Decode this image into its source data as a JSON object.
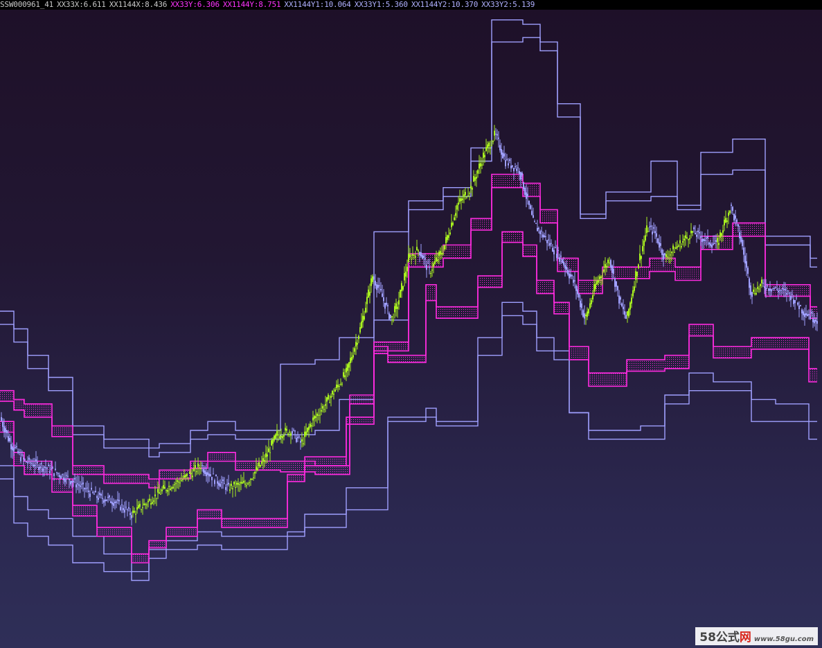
{
  "legend": {
    "items": [
      {
        "text": "SSW000961_41",
        "color": "#c8c8c8"
      },
      {
        "text": "XX33X:6.611",
        "color": "#c8c8c8"
      },
      {
        "text": "XX1144X:8.436",
        "color": "#c8c8c8"
      },
      {
        "text": "XX33Y:6.306",
        "color": "#ff33ff"
      },
      {
        "text": "XX1144Y:8.751",
        "color": "#ff33ff"
      },
      {
        "text": "XX1144Y1:10.064",
        "color": "#b0b0ff"
      },
      {
        "text": "XX33Y1:5.360",
        "color": "#b0b0ff"
      },
      {
        "text": "XX1144Y2:10.370",
        "color": "#b0b0ff"
      },
      {
        "text": "XX33Y2:5.139",
        "color": "#b0b0ff"
      }
    ]
  },
  "watermark": {
    "logo_num": "58",
    "logo_cn": "公式",
    "logo_net": "网",
    "url": "www.58gu.com"
  },
  "colors": {
    "up": "#a8f020",
    "down": "#a0a0ff",
    "band": "#ff2be0",
    "envelope": "#a0a0ff"
  },
  "chart_data": {
    "type": "line",
    "title": "SSW000961_41",
    "ylim": [
      4.2,
      11.4
    ],
    "price_path": [
      [
        0,
        6.8
      ],
      [
        15,
        6.5
      ],
      [
        35,
        6.3
      ],
      [
        60,
        6.25
      ],
      [
        100,
        6.1
      ],
      [
        140,
        5.9
      ],
      [
        165,
        5.85
      ],
      [
        190,
        5.7
      ],
      [
        215,
        5.85
      ],
      [
        240,
        6.0
      ],
      [
        265,
        6.1
      ],
      [
        290,
        6.25
      ],
      [
        310,
        6.1
      ],
      [
        330,
        6.0
      ],
      [
        355,
        6.05
      ],
      [
        380,
        6.3
      ],
      [
        400,
        6.6
      ],
      [
        420,
        6.65
      ],
      [
        435,
        6.5
      ],
      [
        450,
        6.75
      ],
      [
        470,
        6.95
      ],
      [
        500,
        7.3
      ],
      [
        520,
        7.8
      ],
      [
        538,
        8.4
      ],
      [
        550,
        8.2
      ],
      [
        565,
        7.9
      ],
      [
        575,
        8.1
      ],
      [
        590,
        8.6
      ],
      [
        605,
        8.7
      ],
      [
        620,
        8.45
      ],
      [
        640,
        8.7
      ],
      [
        660,
        9.2
      ],
      [
        680,
        9.4
      ],
      [
        700,
        9.8
      ],
      [
        715,
        10.0
      ],
      [
        730,
        9.7
      ],
      [
        750,
        9.6
      ],
      [
        770,
        9.0
      ],
      [
        790,
        8.8
      ],
      [
        810,
        8.6
      ],
      [
        830,
        8.3
      ],
      [
        845,
        7.9
      ],
      [
        860,
        8.3
      ],
      [
        880,
        8.6
      ],
      [
        895,
        8.1
      ],
      [
        905,
        7.9
      ],
      [
        920,
        8.5
      ],
      [
        935,
        8.95
      ],
      [
        945,
        8.9
      ],
      [
        960,
        8.6
      ],
      [
        980,
        8.75
      ],
      [
        1000,
        8.9
      ],
      [
        1020,
        8.8
      ],
      [
        1035,
        8.75
      ],
      [
        1055,
        9.2
      ],
      [
        1070,
        8.8
      ],
      [
        1085,
        8.2
      ],
      [
        1100,
        8.3
      ],
      [
        1120,
        8.25
      ],
      [
        1140,
        8.2
      ],
      [
        1160,
        8.0
      ],
      [
        1180,
        7.9
      ]
    ],
    "series": [
      {
        "name": "XX1144Y1",
        "color": "#a0a0ff",
        "steps": [
          [
            0,
            8.0
          ],
          [
            20,
            7.8
          ],
          [
            40,
            7.5
          ],
          [
            70,
            7.25
          ],
          [
            105,
            6.7
          ],
          [
            150,
            6.55
          ],
          [
            215,
            6.45
          ],
          [
            230,
            6.5
          ],
          [
            275,
            6.65
          ],
          [
            300,
            6.75
          ],
          [
            340,
            6.65
          ],
          [
            405,
            7.4
          ],
          [
            455,
            7.45
          ],
          [
            490,
            7.7
          ],
          [
            540,
            8.9
          ],
          [
            590,
            9.25
          ],
          [
            640,
            9.4
          ],
          [
            680,
            9.85
          ],
          [
            710,
            11.3
          ],
          [
            755,
            11.25
          ],
          [
            780,
            11.05
          ],
          [
            805,
            10.35
          ],
          [
            838,
            9.1
          ],
          [
            875,
            9.35
          ],
          [
            940,
            9.7
          ],
          [
            978,
            9.2
          ],
          [
            1012,
            9.8
          ],
          [
            1058,
            9.95
          ],
          [
            1105,
            8.85
          ],
          [
            1170,
            8.6
          ]
        ]
      },
      {
        "name": "XX1144Y2",
        "color": "#a0a0ff",
        "steps": [
          [
            0,
            7.85
          ],
          [
            20,
            7.65
          ],
          [
            40,
            7.35
          ],
          [
            70,
            7.1
          ],
          [
            105,
            6.6
          ],
          [
            150,
            6.45
          ],
          [
            215,
            6.35
          ],
          [
            230,
            6.4
          ],
          [
            275,
            6.55
          ],
          [
            300,
            6.6
          ],
          [
            340,
            6.55
          ],
          [
            405,
            6.6
          ],
          [
            455,
            6.65
          ],
          [
            490,
            7.0
          ],
          [
            540,
            7.9
          ],
          [
            590,
            9.15
          ],
          [
            640,
            9.3
          ],
          [
            680,
            9.7
          ],
          [
            710,
            11.05
          ],
          [
            755,
            11.1
          ],
          [
            780,
            10.95
          ],
          [
            805,
            10.2
          ],
          [
            838,
            9.05
          ],
          [
            875,
            9.25
          ],
          [
            940,
            9.3
          ],
          [
            978,
            9.15
          ],
          [
            1012,
            9.55
          ],
          [
            1058,
            9.6
          ],
          [
            1105,
            8.75
          ],
          [
            1170,
            8.5
          ]
        ]
      },
      {
        "name": "XX33Y1",
        "color": "#a0a0ff",
        "steps": [
          [
            0,
            6.25
          ],
          [
            20,
            5.9
          ],
          [
            40,
            5.75
          ],
          [
            70,
            5.65
          ],
          [
            105,
            5.45
          ],
          [
            150,
            5.25
          ],
          [
            190,
            5.05
          ],
          [
            215,
            5.3
          ],
          [
            240,
            5.4
          ],
          [
            285,
            5.5
          ],
          [
            320,
            5.45
          ],
          [
            415,
            5.5
          ],
          [
            440,
            5.7
          ],
          [
            500,
            6.0
          ],
          [
            560,
            6.8
          ],
          [
            615,
            6.9
          ],
          [
            630,
            6.75
          ],
          [
            690,
            7.7
          ],
          [
            725,
            8.1
          ],
          [
            755,
            8.0
          ],
          [
            775,
            7.7
          ],
          [
            800,
            7.55
          ],
          [
            822,
            6.85
          ],
          [
            850,
            6.65
          ],
          [
            925,
            6.7
          ],
          [
            960,
            7.05
          ],
          [
            995,
            7.3
          ],
          [
            1030,
            7.2
          ],
          [
            1085,
            7.0
          ],
          [
            1120,
            6.95
          ],
          [
            1168,
            6.75
          ]
        ]
      },
      {
        "name": "XX33Y2",
        "color": "#a0a0ff",
        "steps": [
          [
            0,
            6.1
          ],
          [
            20,
            5.6
          ],
          [
            40,
            5.45
          ],
          [
            70,
            5.35
          ],
          [
            105,
            5.15
          ],
          [
            150,
            5.05
          ],
          [
            190,
            4.95
          ],
          [
            215,
            5.2
          ],
          [
            240,
            5.3
          ],
          [
            285,
            5.35
          ],
          [
            320,
            5.3
          ],
          [
            415,
            5.45
          ],
          [
            440,
            5.55
          ],
          [
            500,
            5.75
          ],
          [
            560,
            6.75
          ],
          [
            615,
            6.8
          ],
          [
            630,
            6.7
          ],
          [
            690,
            7.5
          ],
          [
            725,
            7.95
          ],
          [
            755,
            7.85
          ],
          [
            775,
            7.55
          ],
          [
            800,
            7.45
          ],
          [
            822,
            6.85
          ],
          [
            850,
            6.55
          ],
          [
            925,
            6.55
          ],
          [
            960,
            6.95
          ],
          [
            995,
            7.1
          ],
          [
            1030,
            7.1
          ],
          [
            1085,
            6.75
          ],
          [
            1120,
            6.75
          ],
          [
            1168,
            6.55
          ]
        ]
      },
      {
        "name": "XX33Y",
        "color": "#ff2be0",
        "steps": [
          [
            0,
            6.75
          ],
          [
            20,
            6.4
          ],
          [
            35,
            6.3
          ],
          [
            75,
            6.1
          ],
          [
            105,
            5.8
          ],
          [
            140,
            5.55
          ],
          [
            190,
            5.25
          ],
          [
            215,
            5.4
          ],
          [
            240,
            5.55
          ],
          [
            285,
            5.75
          ],
          [
            320,
            5.65
          ],
          [
            415,
            6.15
          ],
          [
            440,
            6.35
          ],
          [
            500,
            6.8
          ],
          [
            540,
            7.6
          ],
          [
            560,
            7.5
          ],
          [
            615,
            8.3
          ],
          [
            630,
            8.05
          ],
          [
            690,
            8.4
          ],
          [
            725,
            8.9
          ],
          [
            755,
            8.75
          ],
          [
            775,
            8.35
          ],
          [
            800,
            8.1
          ],
          [
            822,
            7.6
          ],
          [
            850,
            7.3
          ],
          [
            905,
            7.45
          ],
          [
            960,
            7.5
          ],
          [
            995,
            7.85
          ],
          [
            1030,
            7.6
          ],
          [
            1085,
            7.7
          ],
          [
            1120,
            7.7
          ],
          [
            1168,
            7.35
          ]
        ]
      },
      {
        "name": "XX1144Y",
        "color": "#ff2be0",
        "steps": [
          [
            0,
            7.1
          ],
          [
            20,
            7.0
          ],
          [
            35,
            6.95
          ],
          [
            75,
            6.7
          ],
          [
            105,
            6.25
          ],
          [
            150,
            6.15
          ],
          [
            215,
            6.1
          ],
          [
            230,
            6.2
          ],
          [
            275,
            6.3
          ],
          [
            300,
            6.4
          ],
          [
            340,
            6.3
          ],
          [
            405,
            6.3
          ],
          [
            455,
            6.25
          ],
          [
            505,
            7.05
          ],
          [
            540,
            7.65
          ],
          [
            590,
            8.65
          ],
          [
            640,
            8.75
          ],
          [
            680,
            9.05
          ],
          [
            710,
            9.55
          ],
          [
            755,
            9.45
          ],
          [
            780,
            9.15
          ],
          [
            805,
            8.6
          ],
          [
            835,
            8.35
          ],
          [
            870,
            8.5
          ],
          [
            938,
            8.6
          ],
          [
            975,
            8.5
          ],
          [
            1012,
            8.85
          ],
          [
            1058,
            9.0
          ],
          [
            1105,
            8.3
          ],
          [
            1170,
            8.05
          ]
        ]
      },
      {
        "name": "XX33X",
        "color": "#ff2be0",
        "steps": [
          [
            0,
            6.63
          ],
          [
            20,
            6.25
          ],
          [
            35,
            6.15
          ],
          [
            75,
            5.95
          ],
          [
            105,
            5.68
          ],
          [
            140,
            5.45
          ],
          [
            190,
            5.15
          ],
          [
            215,
            5.32
          ],
          [
            240,
            5.45
          ],
          [
            285,
            5.65
          ],
          [
            320,
            5.55
          ],
          [
            415,
            6.07
          ],
          [
            440,
            6.25
          ],
          [
            500,
            6.72
          ],
          [
            540,
            7.52
          ],
          [
            560,
            7.42
          ],
          [
            615,
            8.12
          ],
          [
            630,
            7.92
          ],
          [
            690,
            8.27
          ],
          [
            725,
            8.78
          ],
          [
            755,
            8.62
          ],
          [
            775,
            8.2
          ],
          [
            800,
            7.97
          ],
          [
            822,
            7.45
          ],
          [
            850,
            7.15
          ],
          [
            905,
            7.32
          ],
          [
            960,
            7.35
          ],
          [
            995,
            7.72
          ],
          [
            1030,
            7.47
          ],
          [
            1085,
            7.57
          ],
          [
            1120,
            7.57
          ],
          [
            1168,
            7.2
          ]
        ]
      },
      {
        "name": "XX1144X",
        "color": "#ff2be0",
        "steps": [
          [
            0,
            6.98
          ],
          [
            20,
            6.88
          ],
          [
            35,
            6.8
          ],
          [
            75,
            6.58
          ],
          [
            105,
            6.15
          ],
          [
            150,
            6.05
          ],
          [
            215,
            6.0
          ],
          [
            230,
            6.1
          ],
          [
            275,
            6.22
          ],
          [
            300,
            6.3
          ],
          [
            340,
            6.2
          ],
          [
            405,
            6.18
          ],
          [
            455,
            6.15
          ],
          [
            505,
            6.95
          ],
          [
            540,
            7.55
          ],
          [
            590,
            8.5
          ],
          [
            640,
            8.6
          ],
          [
            680,
            8.92
          ],
          [
            710,
            9.4
          ],
          [
            755,
            9.3
          ],
          [
            780,
            9.0
          ],
          [
            805,
            8.45
          ],
          [
            835,
            8.2
          ],
          [
            870,
            8.37
          ],
          [
            938,
            8.45
          ],
          [
            975,
            8.35
          ],
          [
            1012,
            8.7
          ],
          [
            1058,
            8.85
          ],
          [
            1105,
            8.17
          ],
          [
            1170,
            7.92
          ]
        ]
      }
    ]
  }
}
